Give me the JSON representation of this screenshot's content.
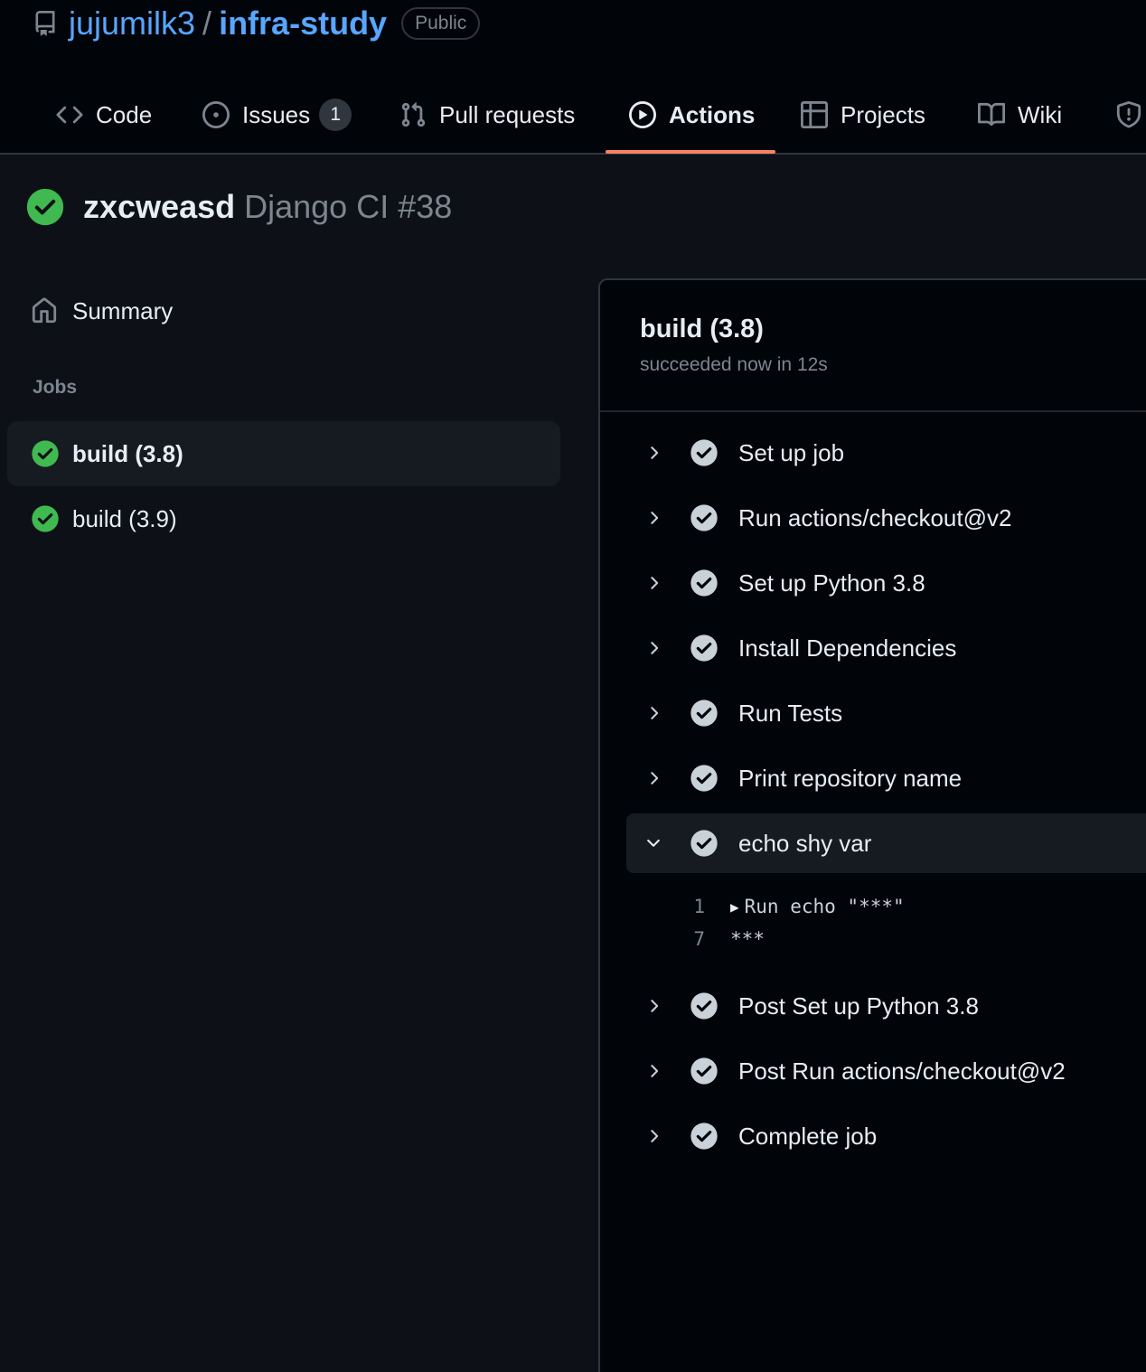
{
  "repo": {
    "owner": "jujumilk3",
    "separator": "/",
    "name": "infra-study",
    "visibility": "Public"
  },
  "tabs": [
    {
      "label": "Code",
      "icon": "code-icon"
    },
    {
      "label": "Issues",
      "icon": "issue-opened-icon",
      "count": "1"
    },
    {
      "label": "Pull requests",
      "icon": "git-pull-request-icon"
    },
    {
      "label": "Actions",
      "icon": "play-icon",
      "selected": true
    },
    {
      "label": "Projects",
      "icon": "table-icon"
    },
    {
      "label": "Wiki",
      "icon": "book-icon"
    },
    {
      "label": "",
      "icon": "shield-icon"
    }
  ],
  "run": {
    "commit": "zxcweasd",
    "workflow": "Django CI #38",
    "status": "success"
  },
  "sidebar": {
    "summary_label": "Summary",
    "jobs_heading": "Jobs",
    "jobs": [
      {
        "label": "build (3.8)",
        "active": true
      },
      {
        "label": "build (3.9)",
        "active": false
      }
    ]
  },
  "job_panel": {
    "title": "build (3.8)",
    "subtitle": "succeeded now in 12s",
    "steps": [
      {
        "label": "Set up job"
      },
      {
        "label": "Run actions/checkout@v2"
      },
      {
        "label": "Set up Python 3.8"
      },
      {
        "label": "Install Dependencies"
      },
      {
        "label": "Run Tests"
      },
      {
        "label": "Print repository name"
      },
      {
        "label": "echo shy var",
        "expanded": true
      },
      {
        "label": "Post Set up Python 3.8"
      },
      {
        "label": "Post Run actions/checkout@v2"
      },
      {
        "label": "Complete job"
      }
    ],
    "log": [
      {
        "num": "1",
        "text": "Run echo \"***\"",
        "collapsible": true
      },
      {
        "num": "7",
        "text": "***",
        "collapsible": false
      }
    ]
  },
  "colors": {
    "accent_link": "#58a6ff",
    "success": "#3fb950",
    "tab_underline": "#f78166",
    "background": "#0d1117"
  }
}
